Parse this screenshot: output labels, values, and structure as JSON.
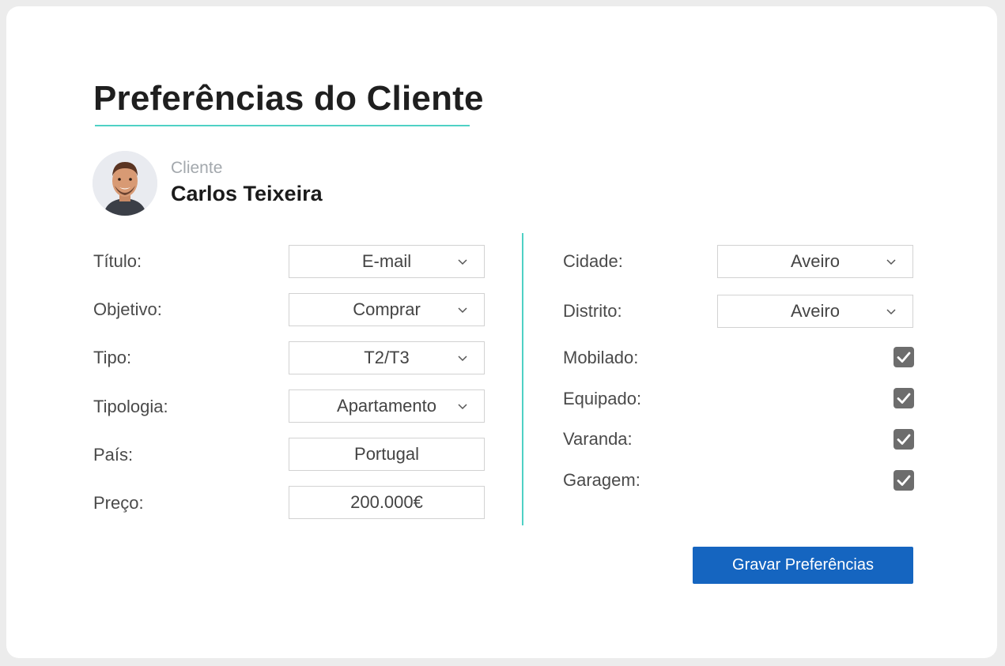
{
  "page": {
    "title": "Preferências do Cliente",
    "accent_color": "#4fd1c5",
    "button_color": "#1565c0"
  },
  "client": {
    "label": "Cliente",
    "name": "Carlos Teixeira",
    "avatar_icon": "user-avatar-photo"
  },
  "left_fields": [
    {
      "label": "Título:",
      "value": "E-mail",
      "type": "select"
    },
    {
      "label": "Objetivo:",
      "value": "Comprar",
      "type": "select"
    },
    {
      "label": "Tipo:",
      "value": "T2/T3",
      "type": "select"
    },
    {
      "label": "Tipologia:",
      "value": "Apartamento",
      "type": "select"
    },
    {
      "label": "País:",
      "value": "Portugal",
      "type": "text"
    },
    {
      "label": "Preço:",
      "value": "200.000€",
      "type": "text"
    }
  ],
  "right_selects": [
    {
      "label": "Cidade:",
      "value": "Aveiro"
    },
    {
      "label": "Distrito:",
      "value": "Aveiro"
    }
  ],
  "right_checkboxes": [
    {
      "label": "Mobilado:",
      "checked": true
    },
    {
      "label": "Equipado:",
      "checked": true
    },
    {
      "label": "Varanda:",
      "checked": true
    },
    {
      "label": "Garagem:",
      "checked": true
    }
  ],
  "actions": {
    "save_label": "Gravar Preferências"
  }
}
